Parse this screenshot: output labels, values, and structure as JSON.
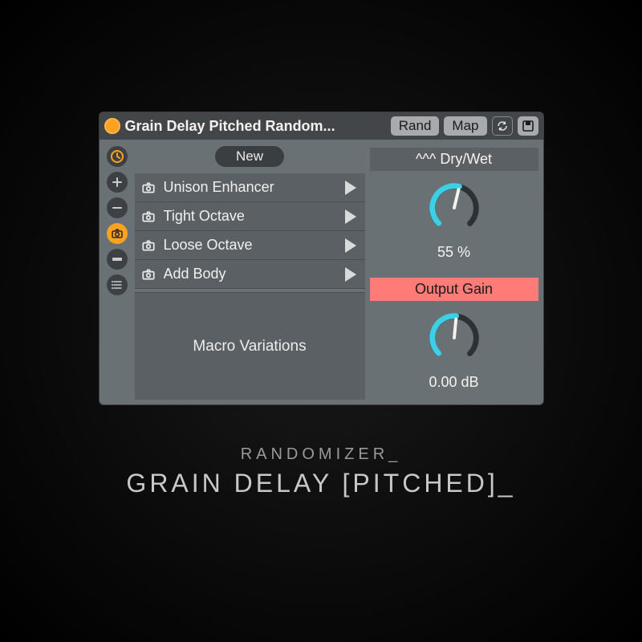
{
  "titlebar": {
    "title": "Grain Delay Pitched Random...",
    "rand_label": "Rand",
    "map_label": "Map"
  },
  "sidebar": {
    "icons": [
      "history",
      "plus",
      "minus",
      "camera",
      "row",
      "list"
    ]
  },
  "main": {
    "new_label": "New",
    "variations": [
      {
        "name": "Unison Enhancer"
      },
      {
        "name": "Tight Octave"
      },
      {
        "name": "Loose Octave"
      },
      {
        "name": "Add Body"
      }
    ],
    "macro_variations_label": "Macro Variations"
  },
  "knobs": {
    "drywet": {
      "label": "^^^ Dry/Wet",
      "value_text": "55 %",
      "value": 55,
      "min": 0,
      "max": 100
    },
    "gain": {
      "label": "Output Gain",
      "value_text": "0.00 dB",
      "value": 0.0,
      "angle_frac": 0.52
    }
  },
  "caption": {
    "line1": "RANDOMIZER_",
    "line2": "GRAIN DELAY [PITCHED]_"
  },
  "colors": {
    "accent": "#ffa220",
    "knob_arc": "#3bd0e6",
    "hot": "#ff7b78"
  }
}
